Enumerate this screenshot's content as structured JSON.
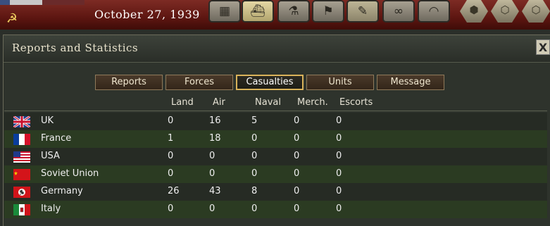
{
  "header": {
    "date": "October 27, 1939",
    "toolbar_icons": [
      "factory-icon",
      "ship-icon",
      "microscope-icon",
      "flag-icon",
      "report-icon",
      "binoculars-icon",
      "helmet-icon"
    ],
    "hex_icons": [
      "hex-single-icon",
      "hex-cluster-icon",
      "hex-extra-icon"
    ]
  },
  "window": {
    "title": "Reports and Statistics",
    "close_label": "X"
  },
  "tabs": [
    {
      "label": "Reports"
    },
    {
      "label": "Forces"
    },
    {
      "label": "Casualties"
    },
    {
      "label": "Units"
    },
    {
      "label": "Message"
    }
  ],
  "columns": [
    "Land",
    "Air",
    "Naval",
    "Merch.",
    "Escorts"
  ],
  "rows": [
    {
      "country": "UK",
      "flag": "uk-flag-icon",
      "land": "0",
      "air": "16",
      "naval": "5",
      "merch": "0",
      "escorts": "0"
    },
    {
      "country": "France",
      "flag": "france-flag-icon",
      "land": "1",
      "air": "18",
      "naval": "0",
      "merch": "0",
      "escorts": "0"
    },
    {
      "country": "USA",
      "flag": "usa-flag-icon",
      "land": "0",
      "air": "0",
      "naval": "0",
      "merch": "0",
      "escorts": "0"
    },
    {
      "country": "Soviet Union",
      "flag": "soviet-flag-icon",
      "land": "0",
      "air": "0",
      "naval": "0",
      "merch": "0",
      "escorts": "0"
    },
    {
      "country": "Germany",
      "flag": "germany-flag-icon",
      "land": "26",
      "air": "43",
      "naval": "8",
      "merch": "0",
      "escorts": "0"
    },
    {
      "country": "Italy",
      "flag": "italy-flag-icon",
      "land": "0",
      "air": "0",
      "naval": "0",
      "merch": "0",
      "escorts": "0"
    }
  ],
  "colors": {
    "selected_tab_border": "#d9b25a",
    "row_even": "#2b3b22",
    "row_odd": "#262b24"
  }
}
